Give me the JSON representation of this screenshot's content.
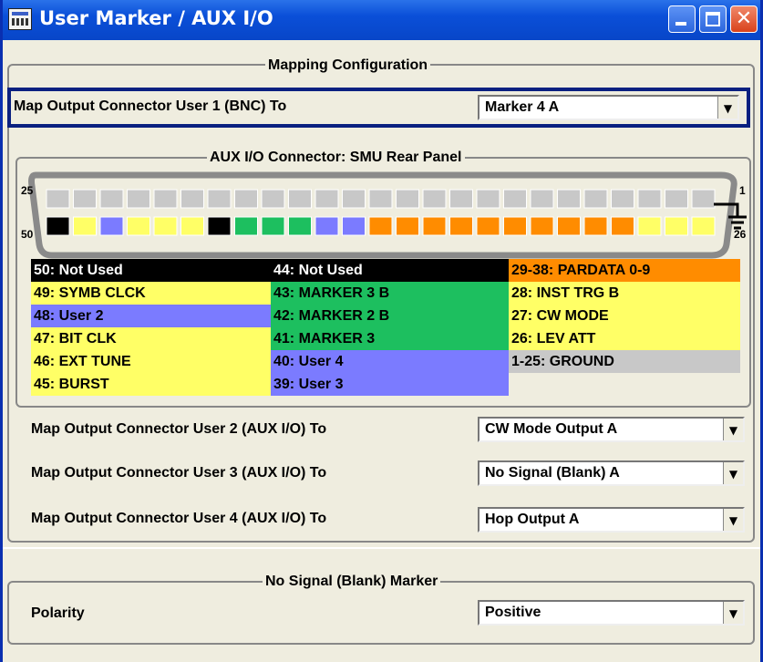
{
  "window": {
    "title": "User Marker / AUX I/O",
    "icon": "dialog-icon"
  },
  "mapping": {
    "legend": "Mapping Configuration",
    "user1_label": "Map Output Connector User 1 (BNC) To",
    "user1_value": "Marker 4 A",
    "connector_legend": "AUX I/O Connector: SMU Rear Panel",
    "pin_labels": {
      "top_left": "25",
      "top_right": "1",
      "bottom_left": "50",
      "bottom_right": "26"
    },
    "pin_colors": {
      "grey": "#c8c8c8",
      "black": "#000000",
      "yellow": "#ffff66",
      "blue": "#7b7bff",
      "green": "#1dbf5f",
      "orange": "#ff8c00",
      "ground": "#c8c8c8"
    },
    "assignments": [
      [
        {
          "text": "50: Not Used",
          "bg": "#000000",
          "fg": "#ffffff"
        },
        {
          "text": "44: Not Used",
          "bg": "#000000",
          "fg": "#ffffff"
        },
        {
          "text": "29-38: PARDATA 0-9",
          "bg": "#ff8c00",
          "fg": "#000000"
        }
      ],
      [
        {
          "text": "49: SYMB CLCK",
          "bg": "#ffff66",
          "fg": "#000000"
        },
        {
          "text": "43: MARKER 3 B",
          "bg": "#1dbf5f",
          "fg": "#000000"
        },
        {
          "text": "28: INST TRG B",
          "bg": "#ffff66",
          "fg": "#000000"
        }
      ],
      [
        {
          "text": "48: User 2",
          "bg": "#7b7bff",
          "fg": "#000000"
        },
        {
          "text": "42: MARKER 2 B",
          "bg": "#1dbf5f",
          "fg": "#000000"
        },
        {
          "text": "27: CW MODE",
          "bg": "#ffff66",
          "fg": "#000000"
        }
      ],
      [
        {
          "text": "47: BIT CLK",
          "bg": "#ffff66",
          "fg": "#000000"
        },
        {
          "text": "41: MARKER 3",
          "bg": "#1dbf5f",
          "fg": "#000000"
        },
        {
          "text": "26: LEV ATT",
          "bg": "#ffff66",
          "fg": "#000000"
        }
      ],
      [
        {
          "text": "46: EXT TUNE",
          "bg": "#ffff66",
          "fg": "#000000"
        },
        {
          "text": "40: User 4",
          "bg": "#7b7bff",
          "fg": "#000000"
        },
        {
          "text": "1-25: GROUND",
          "bg": "#c8c8c8",
          "fg": "#000000"
        }
      ],
      [
        {
          "text": "45: BURST",
          "bg": "#ffff66",
          "fg": "#000000"
        },
        {
          "text": "39: User 3",
          "bg": "#7b7bff",
          "fg": "#000000"
        },
        {
          "text": "",
          "bg": "",
          "fg": ""
        }
      ]
    ],
    "user2_label": "Map Output Connector User 2 (AUX I/O) To",
    "user2_value": "CW Mode Output A",
    "user3_label": "Map Output Connector User 3 (AUX I/O) To",
    "user3_value": "No Signal (Blank) A",
    "user4_label": "Map Output Connector User 4 (AUX I/O) To",
    "user4_value": "Hop Output A"
  },
  "blank_marker": {
    "legend": "No Signal (Blank) Marker",
    "polarity_label": "Polarity",
    "polarity_value": "Positive"
  }
}
